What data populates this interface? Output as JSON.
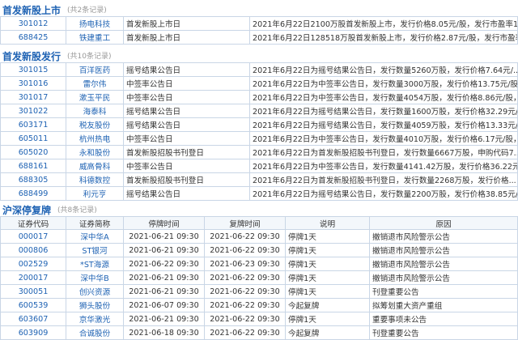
{
  "ipo_listing": {
    "title": "首发新股上市",
    "count": "(共2条记录)",
    "rows": [
      {
        "code": "301012",
        "name": "扬电科技",
        "event": "首发新股上市日",
        "detail": "2021年6月22日2100万股首发新股上市，发行价格8.05元/股，发行市盈率1..."
      },
      {
        "code": "688425",
        "name": "铁建重工",
        "event": "首发新股上市日",
        "detail": "2021年6月22日128518万股首发新股上市，发行价格2.87元/股，发行市盈率1..."
      }
    ]
  },
  "ipo_issue": {
    "title": "首发新股发行",
    "count": "(共10条记录)",
    "rows": [
      {
        "code": "301015",
        "name": "百洋医药",
        "event": "摇号结果公告日",
        "detail": "2021年6月22日为摇号结果公告日，发行数量5260万股，发行价格7.64元/..."
      },
      {
        "code": "301016",
        "name": "雷尔伟",
        "event": "中签率公告日",
        "detail": "2021年6月22日为中签率公告日，发行数量3000万股，发行价格13.75元/股..."
      },
      {
        "code": "301017",
        "name": "漱玉平民",
        "event": "中签率公告日",
        "detail": "2021年6月22日为中签率公告日，发行数量4054万股，发行价格8.86元/股，..."
      },
      {
        "code": "301022",
        "name": "海泰科",
        "event": "摇号结果公告日",
        "detail": "2021年6月22日为摇号结果公告日，发行数量1600万股，发行价格32.29元/..."
      },
      {
        "code": "603171",
        "name": "税友股份",
        "event": "摇号结果公告日",
        "detail": "2021年6月22日为摇号结果公告日，发行数量4059万股，发行价格13.33元/..."
      },
      {
        "code": "605011",
        "name": "杭州热电",
        "event": "中签率公告日",
        "detail": "2021年6月22日为中签率公告日，发行数量4010万股，发行价格6.17元/股，..."
      },
      {
        "code": "605020",
        "name": "永和股份",
        "event": "首发新股招股书刊登日",
        "detail": "2021年6月22日为首发新股招股书刊登日，发行数量6667万股，申购代码7..."
      },
      {
        "code": "688161",
        "name": "威高骨科",
        "event": "中签率公告日",
        "detail": "2021年6月22日为中签率公告日，发行数量4141.42万股，发行价格36.22元..."
      },
      {
        "code": "688305",
        "name": "科德数控",
        "event": "首发新股招股书刊登日",
        "detail": "2021年6月22日为首发新股招股书刊登日，发行数量2268万股，发行价格..."
      },
      {
        "code": "688499",
        "name": "利元亨",
        "event": "摇号结果公告日",
        "detail": "2021年6月22日为摇号结果公告日，发行数量2200万股，发行价格38.85元/..."
      }
    ]
  },
  "suspension": {
    "title": "沪深停复牌",
    "count": "(共8条记录)",
    "columns": [
      "证券代码",
      "证券简称",
      "停牌时间",
      "复牌时间",
      "说明",
      "原因"
    ],
    "rows": [
      {
        "code": "000017",
        "name": "深中华A",
        "stop": "2021-06-21 09:30",
        "resume": "2021-06-22 09:30",
        "note": "停牌1天",
        "reason": "撤销退市风险警示公告"
      },
      {
        "code": "000806",
        "name": "ST银河",
        "stop": "2021-06-21 09:30",
        "resume": "2021-06-22 09:30",
        "note": "停牌1天",
        "reason": "撤销退市风险警示公告"
      },
      {
        "code": "002529",
        "name": "*ST海源",
        "stop": "2021-06-22 09:30",
        "resume": "2021-06-23 09:30",
        "note": "停牌1天",
        "reason": "撤销退市风险警示公告"
      },
      {
        "code": "200017",
        "name": "深中华B",
        "stop": "2021-06-21 09:30",
        "resume": "2021-06-22 09:30",
        "note": "停牌1天",
        "reason": "撤销退市风险警示公告"
      },
      {
        "code": "300051",
        "name": "创兴资源",
        "stop": "2021-06-21 09:30",
        "resume": "2021-06-22 09:30",
        "note": "停牌1天",
        "reason": "刊登重要公告"
      },
      {
        "code": "600539",
        "name": "狮头股份",
        "stop": "2021-06-07 09:30",
        "resume": "2021-06-22 09:30",
        "note": "今起复牌",
        "reason": "拟筹划重大资产重组"
      },
      {
        "code": "603607",
        "name": "京华激光",
        "stop": "2021-06-21 09:30",
        "resume": "2021-06-22 09:30",
        "note": "停牌1天",
        "reason": "重要事项未公告"
      },
      {
        "code": "603909",
        "name": "合诚股份",
        "stop": "2021-06-18 09:30",
        "resume": "2021-06-22 09:30",
        "note": "今起复牌",
        "reason": "刊登重要公告"
      }
    ]
  }
}
